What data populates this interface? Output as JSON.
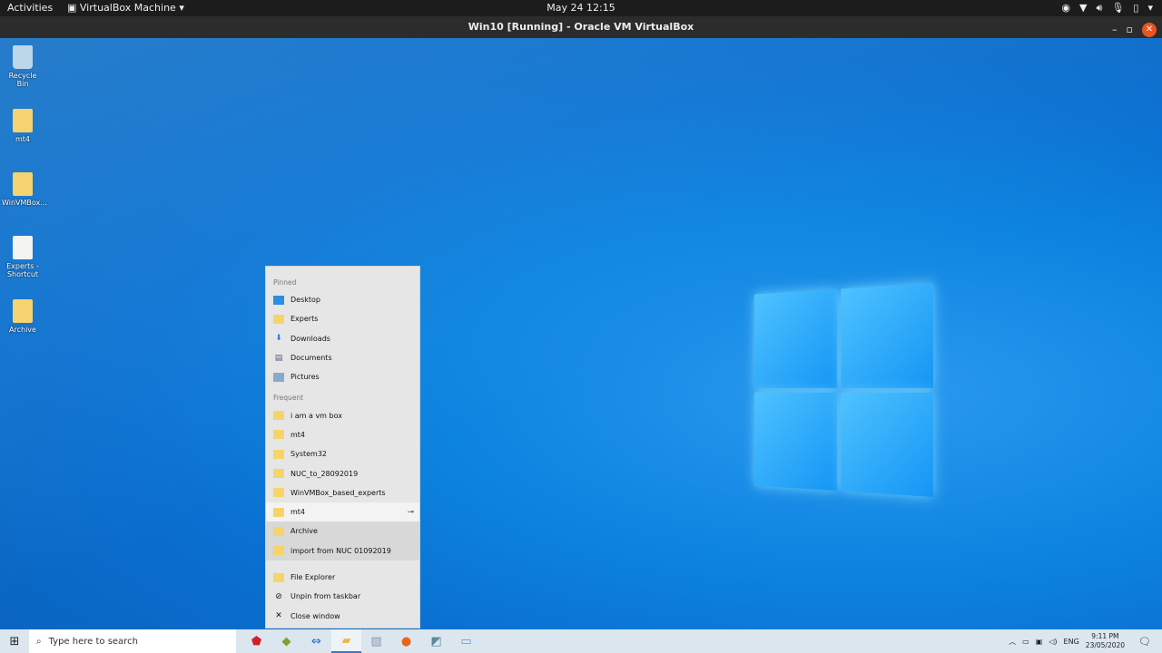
{
  "topbar": {
    "activities": "Activities",
    "app_menu": "VirtualBox Machine",
    "clock": "May 24  12:15"
  },
  "window": {
    "title": "Win10 [Running] - Oracle VM VirtualBox"
  },
  "desktop_icons": [
    {
      "label": "Recycle Bin"
    },
    {
      "label": "mt4"
    },
    {
      "label": "WinVMBox..."
    },
    {
      "label": "Experts - Shortcut"
    },
    {
      "label": "Archive"
    }
  ],
  "jumplist": {
    "pinned_header": "Pinned",
    "pinned": [
      {
        "label": "Desktop",
        "icon": "desktop-icon"
      },
      {
        "label": "Experts",
        "icon": "folder-icon"
      },
      {
        "label": "Downloads",
        "icon": "download-icon"
      },
      {
        "label": "Documents",
        "icon": "documents-icon"
      },
      {
        "label": "Pictures",
        "icon": "pictures-icon"
      }
    ],
    "frequent_header": "Frequent",
    "frequent": [
      {
        "label": "i am a vm box"
      },
      {
        "label": "mt4"
      },
      {
        "label": "System32"
      },
      {
        "label": "NUC_to_28092019"
      },
      {
        "label": "WinVMBox_based_experts"
      },
      {
        "label": "mt4"
      },
      {
        "label": "Archive"
      },
      {
        "label": "import from NUC 01092019"
      }
    ],
    "actions": [
      {
        "label": "File Explorer"
      },
      {
        "label": "Unpin from taskbar"
      },
      {
        "label": "Close window"
      }
    ]
  },
  "taskbar": {
    "search_placeholder": "Type here to search",
    "language": "ENG",
    "time": "9:11 PM",
    "date": "23/05/2020"
  }
}
